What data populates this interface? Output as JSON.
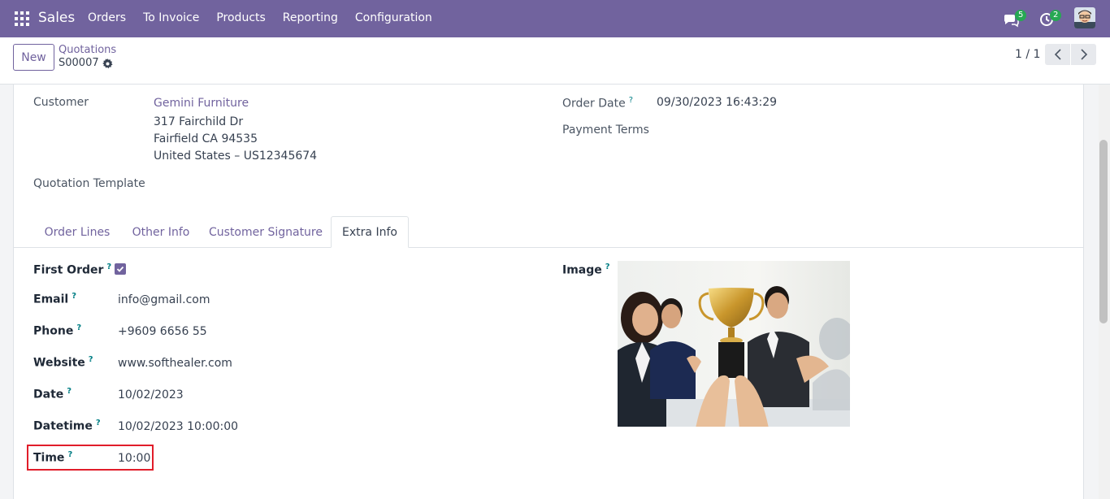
{
  "navbar": {
    "brand": "Sales",
    "menu": [
      "Orders",
      "To Invoice",
      "Products",
      "Reporting",
      "Configuration"
    ],
    "chat_count": "5",
    "activity_count": "2",
    "color": "#71639e"
  },
  "control": {
    "new_label": "New",
    "breadcrumb_parent": "Quotations",
    "breadcrumb_current": "S00007",
    "pager": "1 / 1"
  },
  "form": {
    "customer_label": "Customer",
    "customer_name": "Gemini Furniture",
    "address_line1": "317 Fairchild Dr",
    "address_line2": "Fairfield CA 94535",
    "address_line3": "United States – US12345674",
    "order_date_label": "Order Date",
    "order_date": "09/30/2023 16:43:29",
    "payment_terms_label": "Payment Terms",
    "quotation_template_label": "Quotation Template"
  },
  "tabs": [
    "Order Lines",
    "Other Info",
    "Customer Signature",
    "Extra Info"
  ],
  "extra": {
    "first_order_label": "First Order",
    "email_label": "Email",
    "email": "info@gmail.com",
    "phone_label": "Phone",
    "phone": "+9609 6656 55",
    "website_label": "Website",
    "website": "www.softhealer.com",
    "date_label": "Date",
    "date": "10/02/2023",
    "datetime_label": "Datetime",
    "datetime": "10/02/2023 10:00:00",
    "time_label": "Time",
    "time": "10:00",
    "image_label": "Image",
    "help_mark": "?"
  },
  "icons": {
    "apps": "apps-grid-icon",
    "chat": "chat-bubbles-icon",
    "activity": "clock-activity-icon",
    "gear": "gear-icon",
    "prev": "chevron-left-icon",
    "next": "chevron-right-icon",
    "check": "check-icon"
  }
}
